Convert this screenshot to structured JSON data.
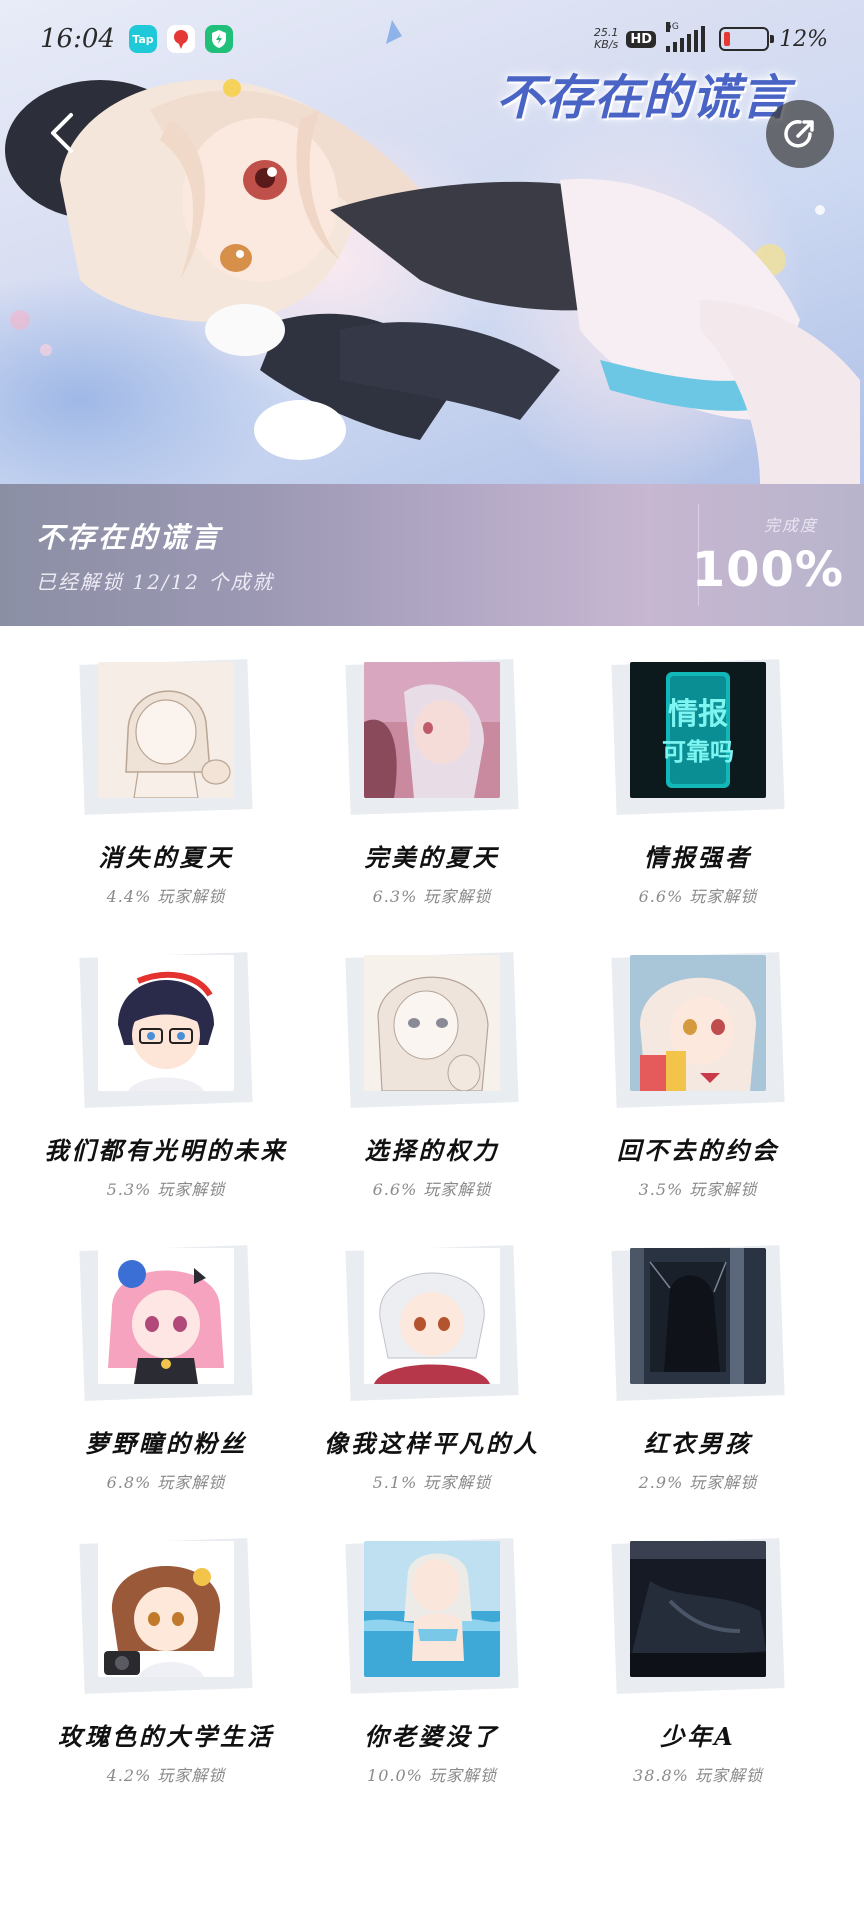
{
  "status_bar": {
    "time": "16:04",
    "app_icons": [
      {
        "name": "taptap-icon",
        "label": "Tap",
        "color": "#1fc9d8"
      },
      {
        "name": "notification-app-icon",
        "label": "",
        "color": "#e53935"
      },
      {
        "name": "shield-app-icon",
        "label": "",
        "color": "#21c07a"
      }
    ],
    "speed_value": "25.1",
    "speed_unit": "KB/s",
    "hd": "HD",
    "network": "5G",
    "battery_percent": "12%"
  },
  "hero": {
    "banner_title": "不存在的谎言"
  },
  "summary": {
    "game_name": "不存在的谎言",
    "unlocked_text": "已经解锁 12/12 个成就",
    "completion_label": "完成度",
    "completion_value": "100%"
  },
  "achievements": [
    {
      "title": "消失的夏天",
      "rate": "4.4% 玩家解锁",
      "art": "sketch"
    },
    {
      "title": "完美的夏天",
      "rate": "6.3% 玩家解锁",
      "art": "pink"
    },
    {
      "title": "情报强者",
      "rate": "6.6% 玩家解锁",
      "art": "info",
      "art_text_1": "情报",
      "art_text_2": "可靠吗"
    },
    {
      "title": "我们都有光明的未来",
      "rate": "5.3% 玩家解锁",
      "art": "boy"
    },
    {
      "title": "选择的权力",
      "rate": "6.6% 玩家解锁",
      "art": "sketch2"
    },
    {
      "title": "回不去的约会",
      "rate": "3.5% 玩家解锁",
      "art": "blonde"
    },
    {
      "title": "萝野瞳的粉丝",
      "rate": "6.8% 玩家解锁",
      "art": "pinkhair"
    },
    {
      "title": "像我这样平凡的人",
      "rate": "5.1% 玩家解锁",
      "art": "silver"
    },
    {
      "title": "红衣男孩",
      "rate": "2.9% 玩家解锁",
      "art": "dark"
    },
    {
      "title": "玫瑰色的大学生活",
      "rate": "4.2% 玩家解锁",
      "art": "brown"
    },
    {
      "title": "你老婆没了",
      "rate": "10.0% 玩家解锁",
      "art": "pool"
    },
    {
      "title": "少年A",
      "rate": "38.8% 玩家解锁",
      "art": "night"
    }
  ]
}
